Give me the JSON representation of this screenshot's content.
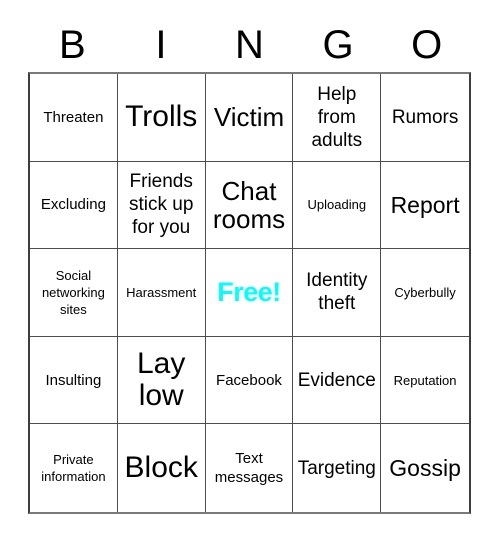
{
  "card": {
    "title": "BINGO",
    "header_letters": [
      "B",
      "I",
      "N",
      "G",
      "O"
    ],
    "free_color": "#00ffff",
    "grid_color": "#4d4d4d",
    "text_color": "#000000",
    "background_color": "#ffffff",
    "columns": 5,
    "rows": 5,
    "cells": [
      {
        "text": "Threaten",
        "size": "sm",
        "free": false
      },
      {
        "text": "Trolls",
        "size": "xxl",
        "free": false
      },
      {
        "text": "Victim",
        "size": "xl",
        "free": false
      },
      {
        "text": "Help from adults",
        "size": "md",
        "free": false
      },
      {
        "text": "Rumors",
        "size": "md",
        "free": false
      },
      {
        "text": "Excluding",
        "size": "sm",
        "free": false
      },
      {
        "text": "Friends stick up for you",
        "size": "md",
        "free": false
      },
      {
        "text": "Chat rooms",
        "size": "xl",
        "free": false
      },
      {
        "text": "Uploading",
        "size": "xs",
        "free": false
      },
      {
        "text": "Report",
        "size": "lg",
        "free": false
      },
      {
        "text": "Social networking sites",
        "size": "xs",
        "free": false
      },
      {
        "text": "Harassment",
        "size": "xs",
        "free": false
      },
      {
        "text": "Free!",
        "size": "lg",
        "free": true
      },
      {
        "text": "Identity theft",
        "size": "md",
        "free": false
      },
      {
        "text": "Cyberbully",
        "size": "xs",
        "free": false
      },
      {
        "text": "Insulting",
        "size": "sm",
        "free": false
      },
      {
        "text": "Lay low",
        "size": "xxl",
        "free": false
      },
      {
        "text": "Facebook",
        "size": "sm",
        "free": false
      },
      {
        "text": "Evidence",
        "size": "md",
        "free": false
      },
      {
        "text": "Reputation",
        "size": "xs",
        "free": false
      },
      {
        "text": "Private information",
        "size": "xs",
        "free": false
      },
      {
        "text": "Block",
        "size": "xxl",
        "free": false
      },
      {
        "text": "Text messages",
        "size": "sm",
        "free": false
      },
      {
        "text": "Targeting",
        "size": "md",
        "free": false
      },
      {
        "text": "Gossip",
        "size": "lg",
        "free": false
      }
    ]
  }
}
